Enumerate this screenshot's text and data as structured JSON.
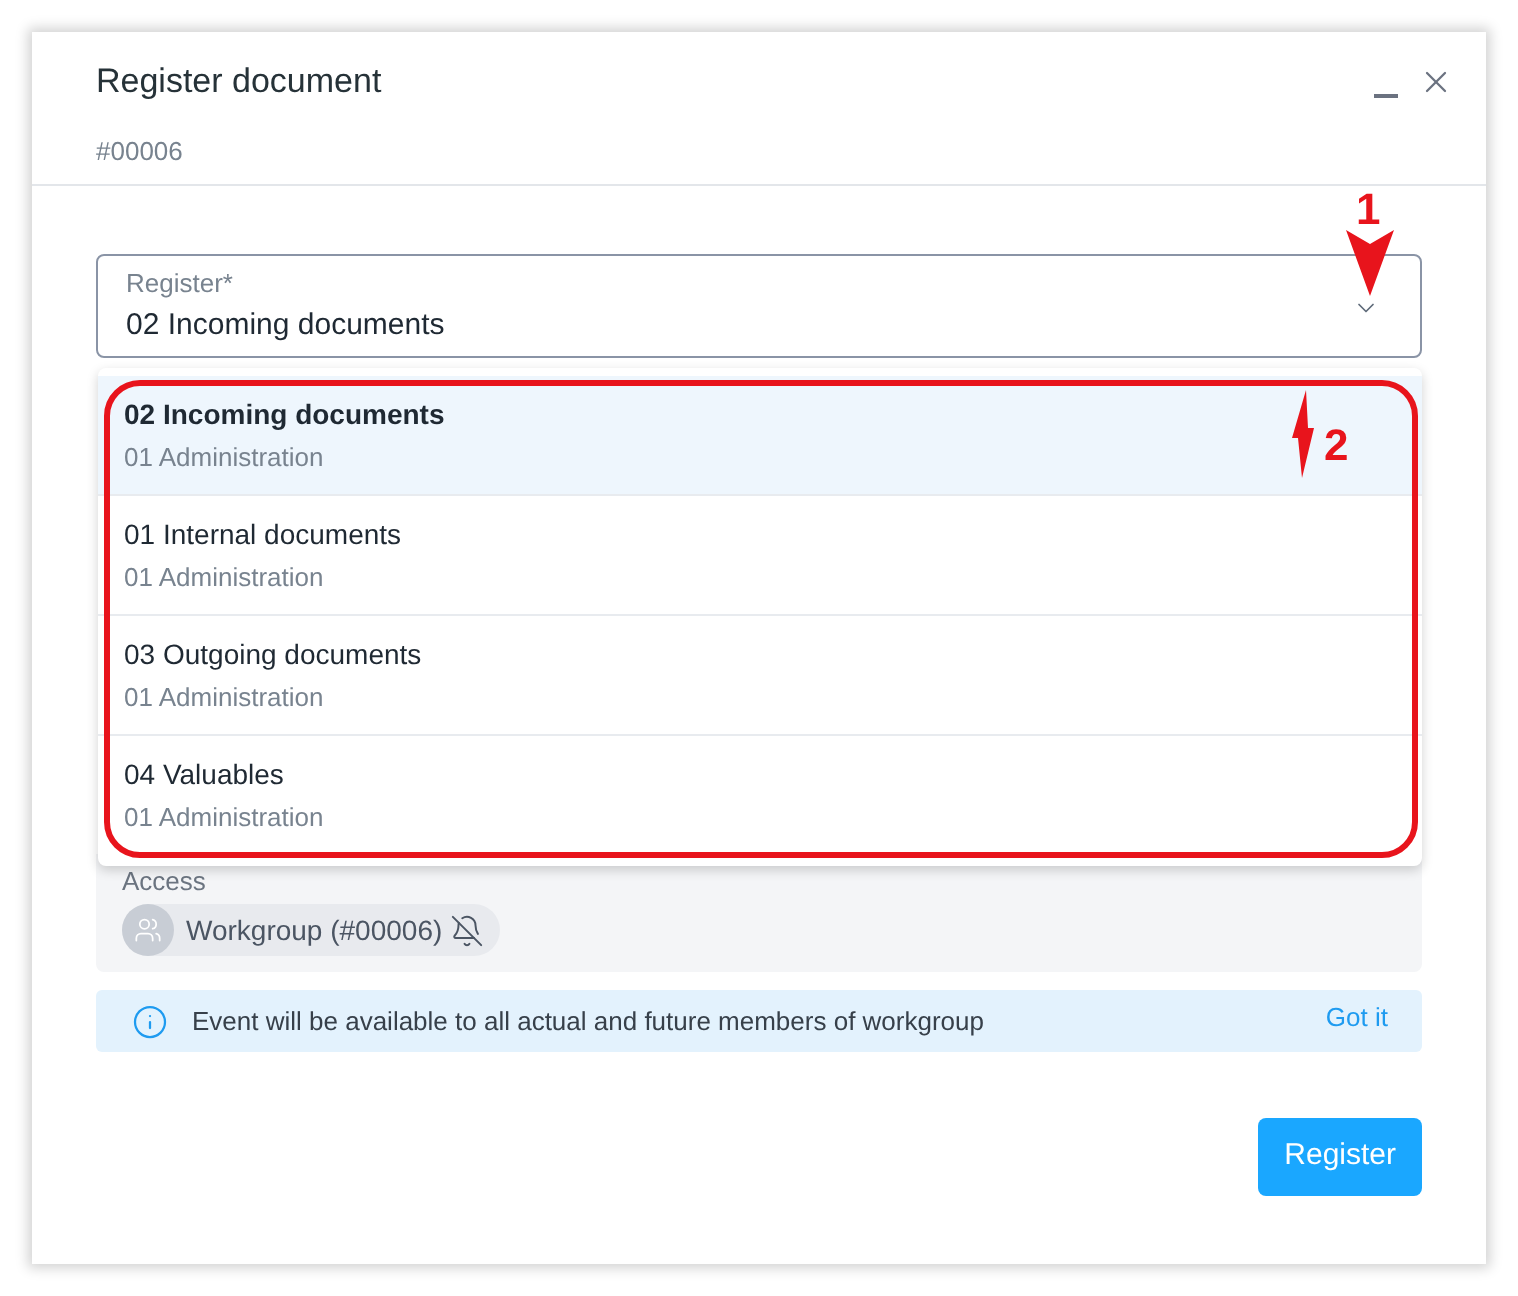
{
  "window": {
    "title": "Register document",
    "subtitle": "#00006"
  },
  "register_field": {
    "label": "Register*",
    "value": "02 Incoming documents",
    "expanded": true
  },
  "dropdown": {
    "options": [
      {
        "title": "02 Incoming documents",
        "subtitle": "01 Administration",
        "selected": true
      },
      {
        "title": "01 Internal documents",
        "subtitle": "01 Administration",
        "selected": false
      },
      {
        "title": "03 Outgoing documents",
        "subtitle": "01 Administration",
        "selected": false
      },
      {
        "title": "04 Valuables",
        "subtitle": "01 Administration",
        "selected": false
      }
    ]
  },
  "access": {
    "label": "Access",
    "chips": [
      {
        "label": "Workgroup (#00006)",
        "notifications_muted": true
      }
    ]
  },
  "info": {
    "text": "Event will be available to all actual and future members of workgroup",
    "action": "Got it"
  },
  "buttons": [
    {
      "label": "Register",
      "kind": "primary"
    }
  ],
  "annotations": [
    {
      "kind": "arrow",
      "label": "1"
    },
    {
      "kind": "arrow",
      "label": "2"
    },
    {
      "kind": "frame"
    }
  ]
}
